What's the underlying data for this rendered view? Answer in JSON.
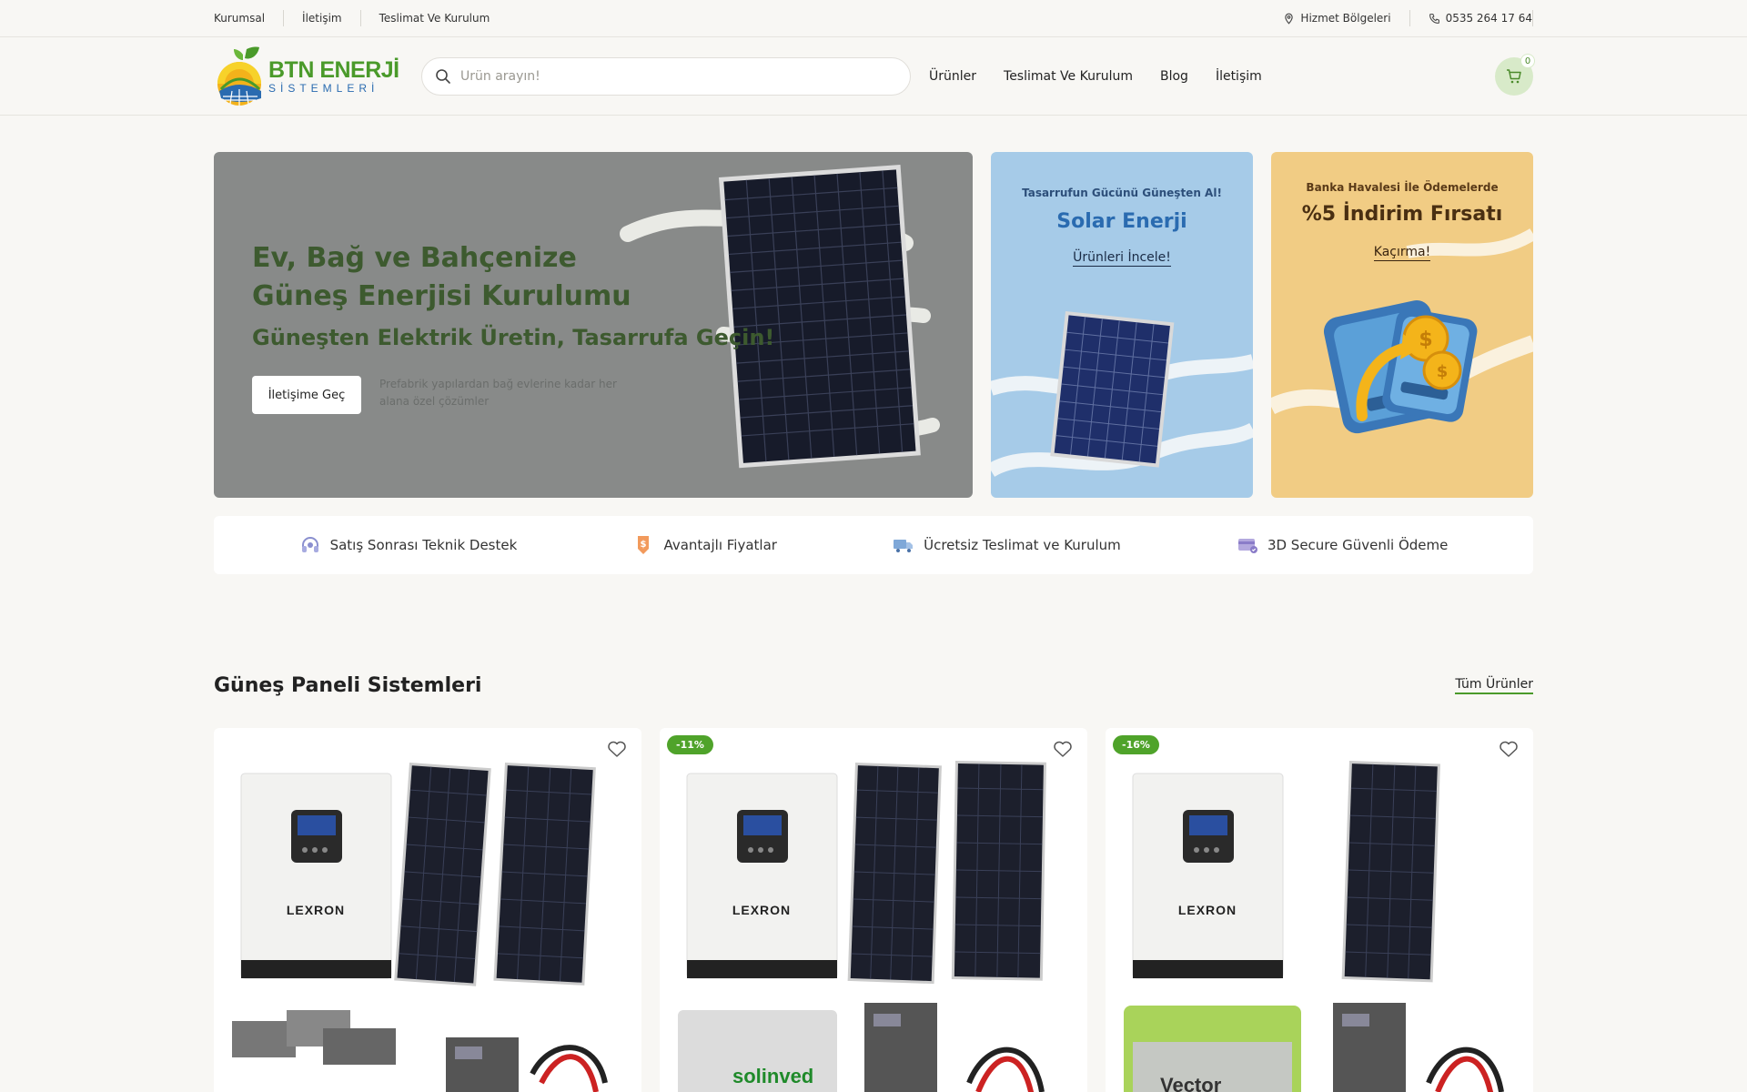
{
  "topbar": {
    "links": [
      "Kurumsal",
      "İletişim",
      "Teslimat Ve Kurulum"
    ],
    "service_regions": "Hizmet Bölgeleri",
    "phone": "0535 264 17 64"
  },
  "header": {
    "logo_line1": "BTN ENERJİ",
    "logo_line2": "SİSTEMLERİ",
    "search_placeholder": "Ürün arayın!",
    "nav": [
      "Ürünler",
      "Teslimat Ve Kurulum",
      "Blog",
      "İletişim"
    ],
    "cart_count": "0"
  },
  "hero": {
    "title_line1": "Ev, Bağ ve Bahçenize",
    "title_line2": "Güneş Enerjisi Kurulumu",
    "subtitle": "Güneşten Elektrik Üretin, Tasarrufa Geçin!",
    "cta": "İletişime Geç",
    "description": "Prefabrik yapılardan bağ evlerine kadar her alana özel çözümler"
  },
  "promos": [
    {
      "kicker": "Tasarrufun Gücünü Güneşten Al!",
      "title": "Solar Enerji",
      "link": "Ürünleri İncele!"
    },
    {
      "kicker": "Banka Havalesi İle Ödemelerde",
      "title": "%5 İndirim Fırsatı",
      "link": "Kaçırma!"
    }
  ],
  "features": [
    {
      "label": "Satış Sonrası Teknik Destek",
      "icon": "headset-icon"
    },
    {
      "label": "Avantajlı Fiyatlar",
      "icon": "price-tag-icon"
    },
    {
      "label": "Ücretsiz Teslimat ve Kurulum",
      "icon": "truck-icon"
    },
    {
      "label": "3D Secure Güvenli Ödeme",
      "icon": "credit-card-icon"
    }
  ],
  "section": {
    "title": "Güneş Paneli Sistemleri",
    "all_link": "Tüm Ürünler"
  },
  "products": [
    {
      "discount": "",
      "inverter_brand": "LEXRON"
    },
    {
      "discount": "-11%",
      "inverter_brand": "LEXRON",
      "battery_brand": "solinved"
    },
    {
      "discount": "-16%",
      "inverter_brand": "LEXRON",
      "battery_brand": "Vector"
    }
  ],
  "colors": {
    "brand_green": "#4a9a2a",
    "brand_blue": "#2a6bb0",
    "hero_bg": "#888a89",
    "promo_blue": "#a6cbe8",
    "promo_yellow": "#f1cc84"
  }
}
